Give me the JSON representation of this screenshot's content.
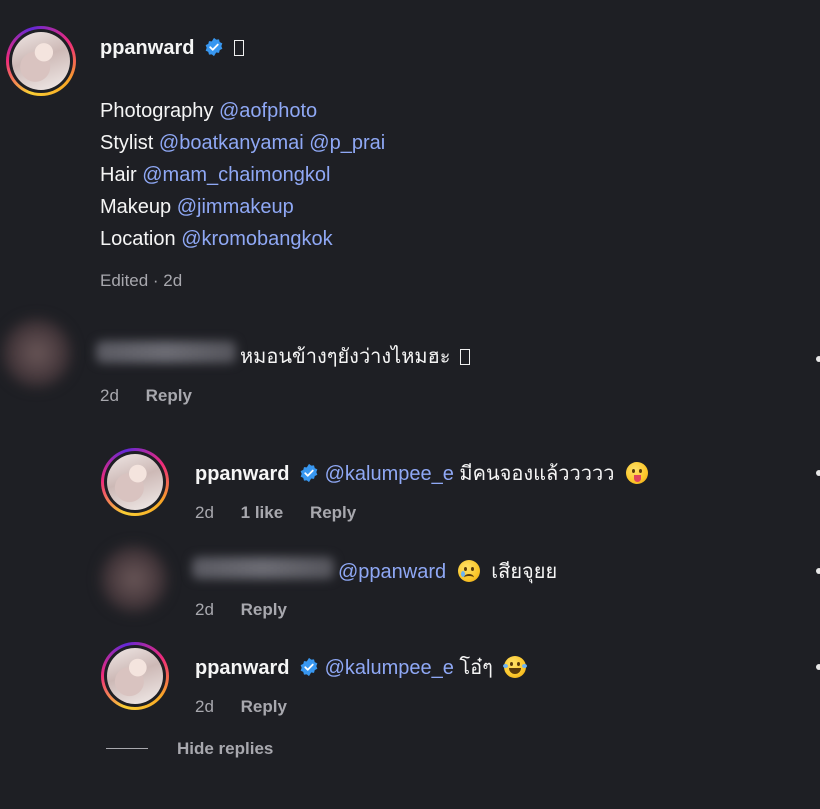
{
  "caption": {
    "username": "ppanward",
    "credits": [
      {
        "role": "Photography",
        "handles": [
          "@aofphoto"
        ]
      },
      {
        "role": "Stylist",
        "handles": [
          "@boatkanyamai",
          "@p_prai"
        ]
      },
      {
        "role": "Hair",
        "handles": [
          "@mam_chaimongkol"
        ]
      },
      {
        "role": "Makeup",
        "handles": [
          "@jimmakeup"
        ]
      },
      {
        "role": "Location",
        "handles": [
          "@kromobangkok"
        ]
      }
    ],
    "meta": "Edited · 2d"
  },
  "comments": [
    {
      "id": "comment-1",
      "author_blurred": true,
      "text": "หมอนข้างๆยังว่างไหมฮะ",
      "time": "2d",
      "reply_label": "Reply"
    }
  ],
  "replies": [
    {
      "username": "ppanward",
      "mention": "@kalumpee_e",
      "text": "มีคนจองแล้ววววว",
      "emoji": "face-with-tongue-emoji",
      "time": "2d",
      "likes": "1 like",
      "reply_label": "Reply"
    },
    {
      "author_blurred": true,
      "mention": "@ppanward",
      "emoji": "crying-face-emoji",
      "text": "เสียจุยย",
      "time": "2d",
      "reply_label": "Reply"
    },
    {
      "username": "ppanward",
      "mention": "@kalumpee_e",
      "text": "โอ๋ๆ",
      "emoji": "tears-of-joy-emoji",
      "time": "2d",
      "reply_label": "Reply"
    }
  ],
  "hide_replies_label": "Hide replies",
  "colors": {
    "background": "#1e1f24",
    "mention": "#8fa8f5",
    "verified": "#3897f0",
    "secondary_text": "#a8a8ae"
  }
}
